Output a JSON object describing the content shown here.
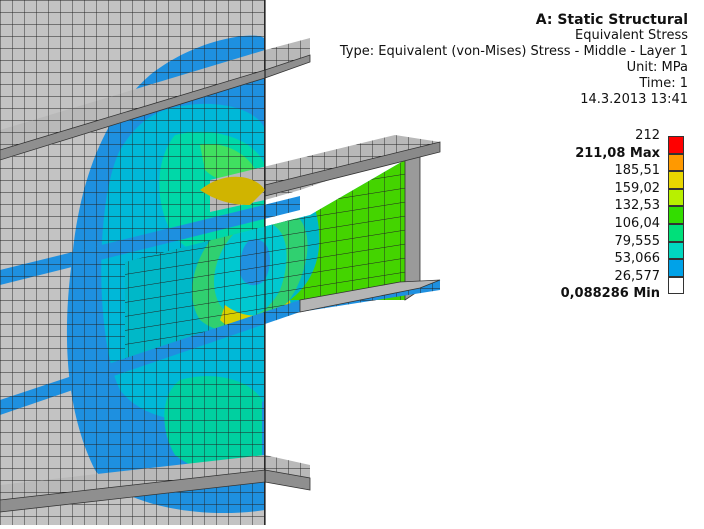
{
  "info": {
    "title": "A: Static Structural",
    "result": "Equivalent Stress",
    "type": "Type: Equivalent (von-Mises) Stress - Middle - Layer 1",
    "unit": "Unit: MPa",
    "time": "Time: 1",
    "date": "14.3.2013 13:41"
  },
  "legend": {
    "labels": [
      "212",
      "211,08 Max",
      "185,51",
      "159,02",
      "132,53",
      "106,04",
      "79,555",
      "53,066",
      "26,577",
      "0,088286 Min"
    ],
    "bold": [
      false,
      true,
      false,
      false,
      false,
      false,
      false,
      false,
      false,
      true
    ],
    "colors": [
      "#ff0000",
      "#ff9900",
      "#e8d800",
      "#b8f000",
      "#33dd00",
      "#00e07a",
      "#00d8c0",
      "#00a2e8",
      "#ffffff"
    ]
  }
}
